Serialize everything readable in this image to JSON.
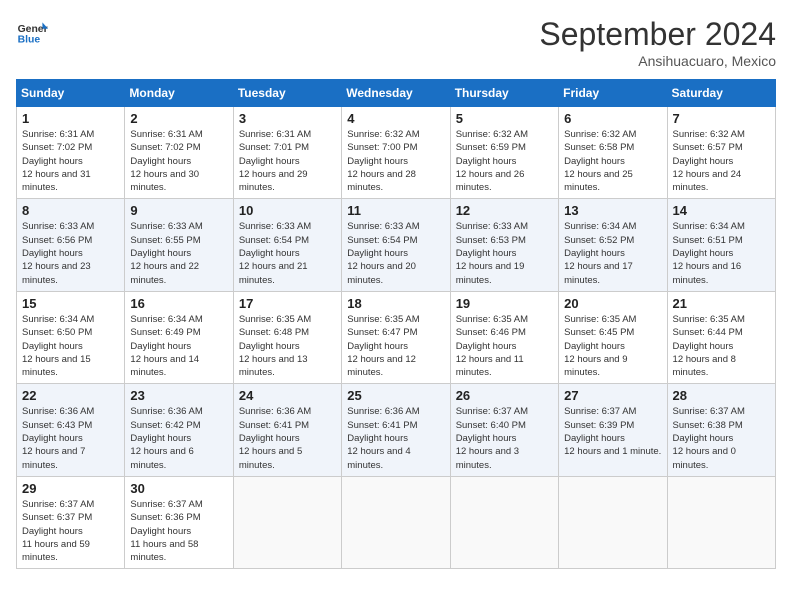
{
  "header": {
    "logo_line1": "General",
    "logo_line2": "Blue",
    "month": "September 2024",
    "location": "Ansihuacuaro, Mexico"
  },
  "weekdays": [
    "Sunday",
    "Monday",
    "Tuesday",
    "Wednesday",
    "Thursday",
    "Friday",
    "Saturday"
  ],
  "weeks": [
    [
      {
        "day": "1",
        "rise": "6:31 AM",
        "set": "7:02 PM",
        "hours": "12 hours and 31 minutes."
      },
      {
        "day": "2",
        "rise": "6:31 AM",
        "set": "7:02 PM",
        "hours": "12 hours and 30 minutes."
      },
      {
        "day": "3",
        "rise": "6:31 AM",
        "set": "7:01 PM",
        "hours": "12 hours and 29 minutes."
      },
      {
        "day": "4",
        "rise": "6:32 AM",
        "set": "7:00 PM",
        "hours": "12 hours and 28 minutes."
      },
      {
        "day": "5",
        "rise": "6:32 AM",
        "set": "6:59 PM",
        "hours": "12 hours and 26 minutes."
      },
      {
        "day": "6",
        "rise": "6:32 AM",
        "set": "6:58 PM",
        "hours": "12 hours and 25 minutes."
      },
      {
        "day": "7",
        "rise": "6:32 AM",
        "set": "6:57 PM",
        "hours": "12 hours and 24 minutes."
      }
    ],
    [
      {
        "day": "8",
        "rise": "6:33 AM",
        "set": "6:56 PM",
        "hours": "12 hours and 23 minutes."
      },
      {
        "day": "9",
        "rise": "6:33 AM",
        "set": "6:55 PM",
        "hours": "12 hours and 22 minutes."
      },
      {
        "day": "10",
        "rise": "6:33 AM",
        "set": "6:54 PM",
        "hours": "12 hours and 21 minutes."
      },
      {
        "day": "11",
        "rise": "6:33 AM",
        "set": "6:54 PM",
        "hours": "12 hours and 20 minutes."
      },
      {
        "day": "12",
        "rise": "6:33 AM",
        "set": "6:53 PM",
        "hours": "12 hours and 19 minutes."
      },
      {
        "day": "13",
        "rise": "6:34 AM",
        "set": "6:52 PM",
        "hours": "12 hours and 17 minutes."
      },
      {
        "day": "14",
        "rise": "6:34 AM",
        "set": "6:51 PM",
        "hours": "12 hours and 16 minutes."
      }
    ],
    [
      {
        "day": "15",
        "rise": "6:34 AM",
        "set": "6:50 PM",
        "hours": "12 hours and 15 minutes."
      },
      {
        "day": "16",
        "rise": "6:34 AM",
        "set": "6:49 PM",
        "hours": "12 hours and 14 minutes."
      },
      {
        "day": "17",
        "rise": "6:35 AM",
        "set": "6:48 PM",
        "hours": "12 hours and 13 minutes."
      },
      {
        "day": "18",
        "rise": "6:35 AM",
        "set": "6:47 PM",
        "hours": "12 hours and 12 minutes."
      },
      {
        "day": "19",
        "rise": "6:35 AM",
        "set": "6:46 PM",
        "hours": "12 hours and 11 minutes."
      },
      {
        "day": "20",
        "rise": "6:35 AM",
        "set": "6:45 PM",
        "hours": "12 hours and 9 minutes."
      },
      {
        "day": "21",
        "rise": "6:35 AM",
        "set": "6:44 PM",
        "hours": "12 hours and 8 minutes."
      }
    ],
    [
      {
        "day": "22",
        "rise": "6:36 AM",
        "set": "6:43 PM",
        "hours": "12 hours and 7 minutes."
      },
      {
        "day": "23",
        "rise": "6:36 AM",
        "set": "6:42 PM",
        "hours": "12 hours and 6 minutes."
      },
      {
        "day": "24",
        "rise": "6:36 AM",
        "set": "6:41 PM",
        "hours": "12 hours and 5 minutes."
      },
      {
        "day": "25",
        "rise": "6:36 AM",
        "set": "6:41 PM",
        "hours": "12 hours and 4 minutes."
      },
      {
        "day": "26",
        "rise": "6:37 AM",
        "set": "6:40 PM",
        "hours": "12 hours and 3 minutes."
      },
      {
        "day": "27",
        "rise": "6:37 AM",
        "set": "6:39 PM",
        "hours": "12 hours and 1 minute."
      },
      {
        "day": "28",
        "rise": "6:37 AM",
        "set": "6:38 PM",
        "hours": "12 hours and 0 minutes."
      }
    ],
    [
      {
        "day": "29",
        "rise": "6:37 AM",
        "set": "6:37 PM",
        "hours": "11 hours and 59 minutes."
      },
      {
        "day": "30",
        "rise": "6:37 AM",
        "set": "6:36 PM",
        "hours": "11 hours and 58 minutes."
      },
      null,
      null,
      null,
      null,
      null
    ]
  ]
}
